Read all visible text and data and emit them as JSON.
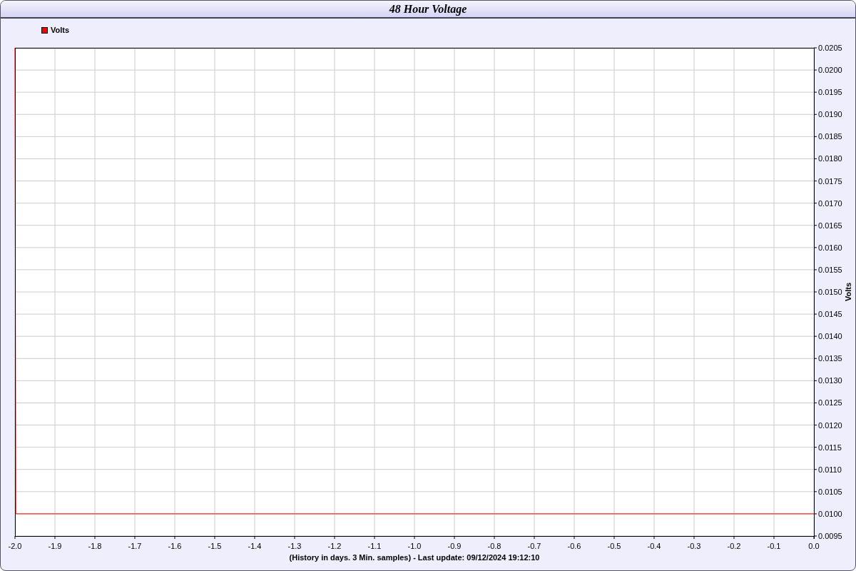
{
  "window": {
    "title": "48 Hour Voltage"
  },
  "chart_data": {
    "type": "line",
    "xlabel": "(History in days. 3 Min. samples) - Last update: 09/12/2024 19:12:10",
    "ylabel": "Volts",
    "x": [
      -2.0,
      -1.998,
      0.0
    ],
    "series": [
      {
        "name": "Volts",
        "color": "#ff0000",
        "values": [
          0.0205,
          0.01,
          0.01
        ]
      }
    ],
    "grid": true,
    "xlim": [
      -2.0,
      0.0
    ],
    "ylim": [
      0.0095,
      0.0205
    ],
    "xticks": [
      {
        "value": -2.0,
        "label": "-2.0"
      },
      {
        "value": -1.9,
        "label": "-1.9"
      },
      {
        "value": -1.8,
        "label": "-1.8"
      },
      {
        "value": -1.7,
        "label": "-1.7"
      },
      {
        "value": -1.6,
        "label": "-1.6"
      },
      {
        "value": -1.5,
        "label": "-1.5"
      },
      {
        "value": -1.4,
        "label": "-1.4"
      },
      {
        "value": -1.3,
        "label": "-1.3"
      },
      {
        "value": -1.2,
        "label": "-1.2"
      },
      {
        "value": -1.1,
        "label": "-1.1"
      },
      {
        "value": -1.0,
        "label": "-1.0"
      },
      {
        "value": -0.9,
        "label": "-0.9"
      },
      {
        "value": -0.8,
        "label": "-0.8"
      },
      {
        "value": -0.7,
        "label": "-0.7"
      },
      {
        "value": -0.6,
        "label": "-0.6"
      },
      {
        "value": -0.5,
        "label": "-0.5"
      },
      {
        "value": -0.4,
        "label": "-0.4"
      },
      {
        "value": -0.3,
        "label": "-0.3"
      },
      {
        "value": -0.2,
        "label": "-0.2"
      },
      {
        "value": -0.1,
        "label": "-0.1"
      },
      {
        "value": 0.0,
        "label": "0.0"
      }
    ],
    "yticks": [
      {
        "value": 0.0205,
        "label": "0.0205"
      },
      {
        "value": 0.02,
        "label": "0.0200"
      },
      {
        "value": 0.0195,
        "label": "0.0195"
      },
      {
        "value": 0.019,
        "label": "0.0190"
      },
      {
        "value": 0.0185,
        "label": "0.0185"
      },
      {
        "value": 0.018,
        "label": "0.0180"
      },
      {
        "value": 0.0175,
        "label": "0.0175"
      },
      {
        "value": 0.017,
        "label": "0.0170"
      },
      {
        "value": 0.0165,
        "label": "0.0165"
      },
      {
        "value": 0.016,
        "label": "0.0160"
      },
      {
        "value": 0.0155,
        "label": "0.0155"
      },
      {
        "value": 0.015,
        "label": "0.0150"
      },
      {
        "value": 0.0145,
        "label": "0.0145"
      },
      {
        "value": 0.014,
        "label": "0.0140"
      },
      {
        "value": 0.0135,
        "label": "0.0135"
      },
      {
        "value": 0.013,
        "label": "0.0130"
      },
      {
        "value": 0.0125,
        "label": "0.0125"
      },
      {
        "value": 0.012,
        "label": "0.0120"
      },
      {
        "value": 0.0115,
        "label": "0.0115"
      },
      {
        "value": 0.011,
        "label": "0.0110"
      },
      {
        "value": 0.0105,
        "label": "0.0105"
      },
      {
        "value": 0.01,
        "label": "0.0100"
      },
      {
        "value": 0.0095,
        "label": "0.0095"
      }
    ]
  }
}
